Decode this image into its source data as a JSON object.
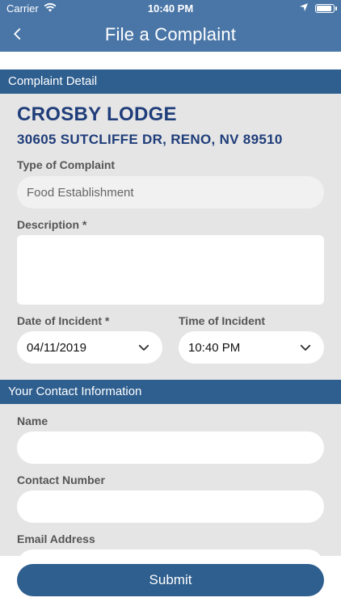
{
  "status_bar": {
    "carrier": "Carrier",
    "time": "10:40 PM"
  },
  "nav": {
    "title": "File a Complaint"
  },
  "section_complaint": {
    "heading": "Complaint Detail",
    "establishment_name": "CROSBY LODGE",
    "establishment_address": "30605 SUTCLIFFE DR, RENO, NV 89510",
    "type_label": "Type of Complaint",
    "type_value": "Food Establishment",
    "description_label": "Description *",
    "date_label": "Date of Incident *",
    "date_value": "04/11/2019",
    "time_label": "Time of Incident",
    "time_value": "10:40 PM"
  },
  "section_contact": {
    "heading": "Your Contact Information",
    "name_label": "Name",
    "contact_label": "Contact Number",
    "email_label": "Email Address"
  },
  "actions": {
    "submit_label": "Submit"
  },
  "colors": {
    "header_bg": "#4a76a7",
    "section_bar": "#2f5f8f",
    "title_text": "#1f3d7a",
    "content_bg": "#e5e5e5"
  }
}
